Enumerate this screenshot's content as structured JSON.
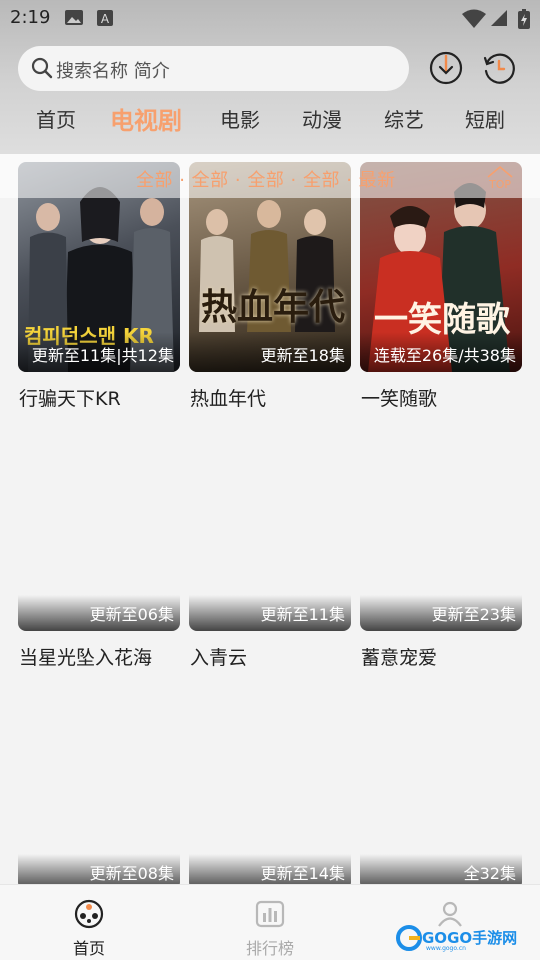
{
  "status": {
    "time": "2:19"
  },
  "search": {
    "placeholder": "搜索名称 简介"
  },
  "tabs": [
    "首页",
    "电视剧",
    "电影",
    "动漫",
    "综艺",
    "短剧"
  ],
  "filter": {
    "text": "全部 · 全部 · 全部 · 全部 · 最新",
    "top_label": "TOP"
  },
  "cards": [
    {
      "badge": "更新至11集|共12集",
      "title": "行骗天下KR"
    },
    {
      "badge": "更新至18集",
      "title": "热血年代"
    },
    {
      "badge": "连载至26集/共38集",
      "title": "一笑随歌"
    },
    {
      "badge": "更新至06集",
      "title": "当星光坠入花海"
    },
    {
      "badge": "更新至11集",
      "title": "入青云"
    },
    {
      "badge": "更新至23集",
      "title": "蓄意宠爱"
    },
    {
      "badge": "更新至08集",
      "title": ""
    },
    {
      "badge": "更新至14集",
      "title": ""
    },
    {
      "badge": "全32集",
      "title": ""
    }
  ],
  "poster_text": {
    "p1": "컴피던스맨 KR",
    "p2": "热血年代",
    "p3": "一笑随歌"
  },
  "bottom_nav": [
    {
      "label": "首页",
      "icon": "film-reel-icon",
      "active": true
    },
    {
      "label": "排行榜",
      "icon": "bar-chart-icon",
      "active": false
    },
    {
      "label": "",
      "icon": "user-icon",
      "active": false
    }
  ],
  "watermark": {
    "text": "GOGO手游网",
    "sub": "www.gogo.cn"
  },
  "colors": {
    "accent": "#f7a06e",
    "header": "#c8c8c8"
  }
}
